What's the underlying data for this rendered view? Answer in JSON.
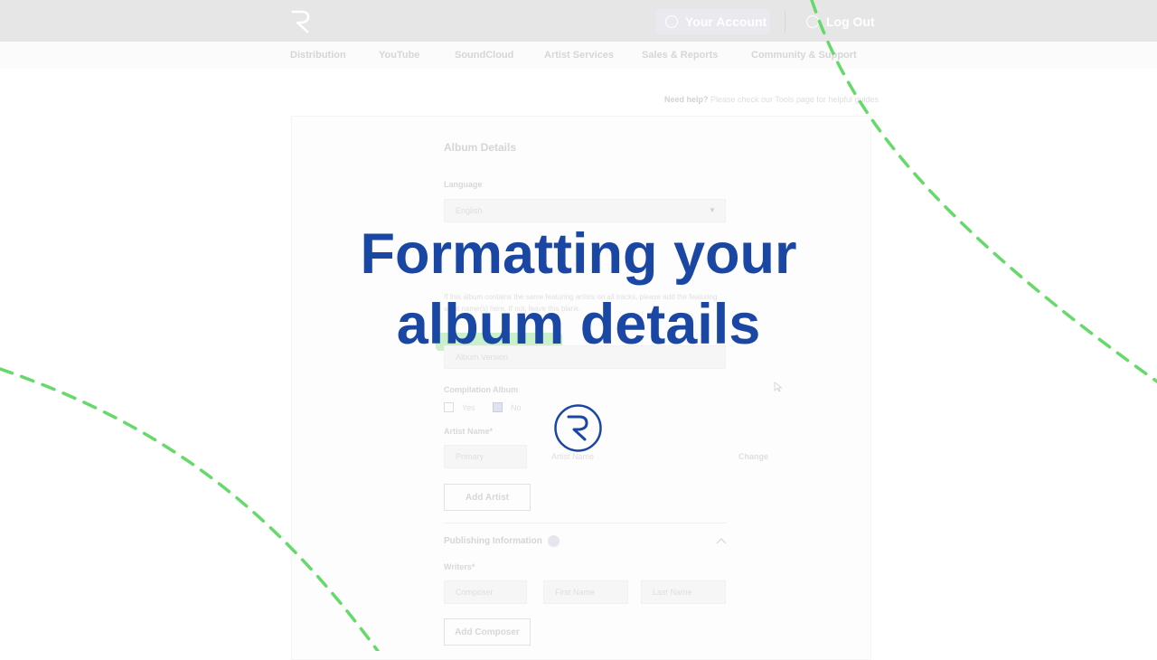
{
  "header": {
    "account_label": "Your Account",
    "logout_label": "Log Out"
  },
  "nav": [
    "Distribution",
    "YouTube",
    "SoundCloud",
    "Artist Services",
    "Sales & Reports",
    "Community & Support"
  ],
  "help": {
    "bold": "Need help?",
    "text": " Please check our Tools page for helpful guides"
  },
  "form": {
    "section_title": "Album Details",
    "language_label": "Language",
    "language_value": "English",
    "note": "If this album contains the same featuring artists on all tracks, please add the featuring artist name(s) here. If not, leave this blank.",
    "album_version_placeholder": "Album Version",
    "compilation_label": "Compilation Album",
    "yes_label": "Yes",
    "no_label": "No",
    "artist_name_label": "Artist Name*",
    "artist_role": "Primary",
    "artist_name_placeholder": "Artist Name",
    "change_label": "Change",
    "add_artist_label": "Add Artist",
    "publishing_label": "Publishing Information",
    "writers_label": "Writers*",
    "composer_role": "Composer",
    "first_name_placeholder": "First Name",
    "last_name_placeholder": "Last Name",
    "add_composer_label": "Add Composer"
  },
  "overlay": {
    "title_line1": "Formatting your",
    "title_line2": "album details"
  },
  "colors": {
    "title": "#1b47a4",
    "dash": "#66d96b"
  },
  "icons": [
    "logo-icon",
    "user-icon",
    "logout-icon",
    "dropdown-arrow-icon",
    "info-icon",
    "chevron-up-icon",
    "cursor-icon"
  ]
}
